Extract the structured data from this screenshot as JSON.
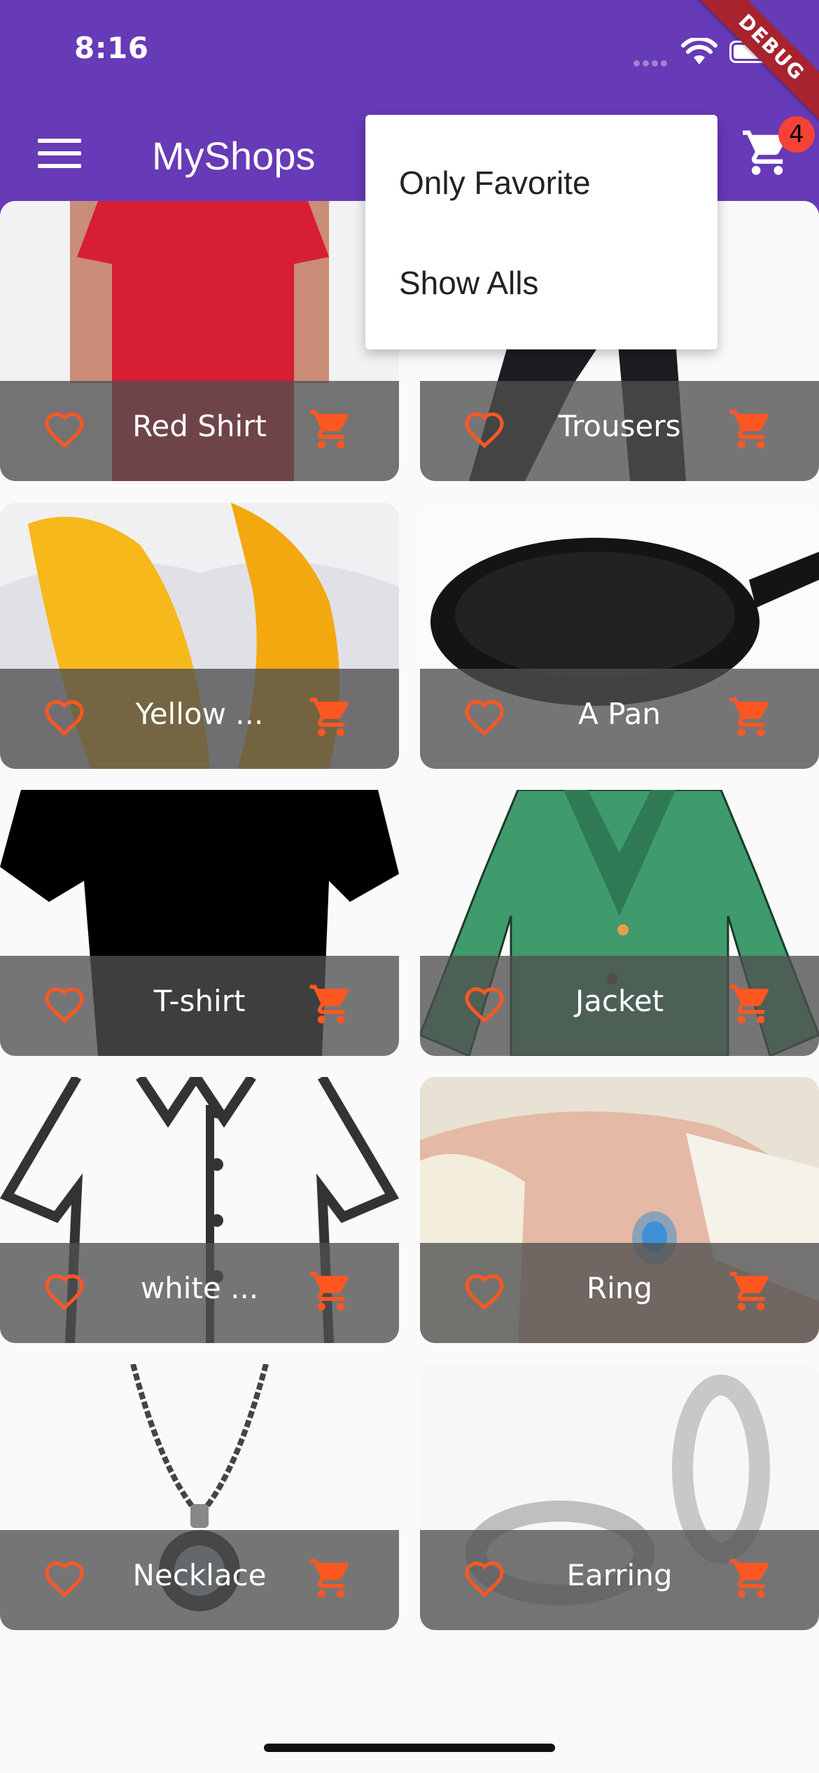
{
  "status_bar": {
    "time": "8:16"
  },
  "debug_banner": "DEBUG",
  "app_bar": {
    "title": "MyShops",
    "cart_count": "4"
  },
  "popup_menu": {
    "items": [
      "Only Favorite",
      "Show Alls"
    ]
  },
  "products": [
    {
      "title": "Red Shirt",
      "image": "red-shirt"
    },
    {
      "title": "Trousers",
      "image": "trousers"
    },
    {
      "title": "Yellow ...",
      "image": "yellow-scarf"
    },
    {
      "title": "A Pan",
      "image": "pan"
    },
    {
      "title": "T-shirt",
      "image": "black-tshirt"
    },
    {
      "title": "Jacket",
      "image": "green-jacket"
    },
    {
      "title": "white ...",
      "image": "white-shirt"
    },
    {
      "title": "Ring",
      "image": "ring"
    },
    {
      "title": "Necklace",
      "image": "necklace"
    },
    {
      "title": "Earring",
      "image": "earring"
    }
  ],
  "colors": {
    "primary": "#673ab7",
    "accent": "#ff5722",
    "badge": "#f44336"
  }
}
